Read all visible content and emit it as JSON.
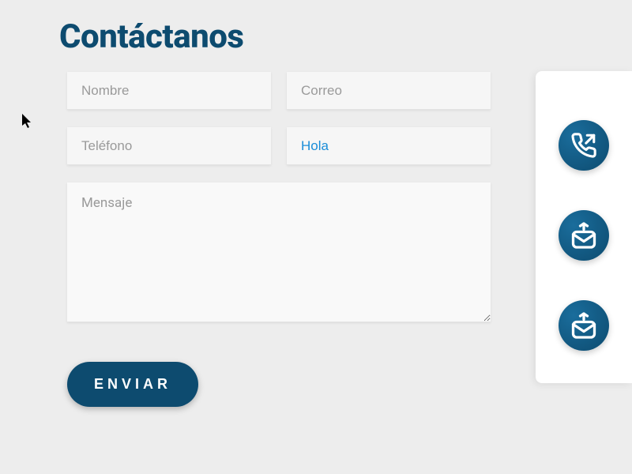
{
  "title": "Contáctanos",
  "form": {
    "name_placeholder": "Nombre",
    "email_placeholder": "Correo",
    "phone_placeholder": "Teléfono",
    "subject_value": "Hola",
    "message_placeholder": "Mensaje",
    "submit_label": "ENVIAR"
  },
  "colors": {
    "primary": "#0d4b6f",
    "accent": "#1a8dd8",
    "background": "#ededed",
    "input_bg": "#f6f6f6"
  }
}
